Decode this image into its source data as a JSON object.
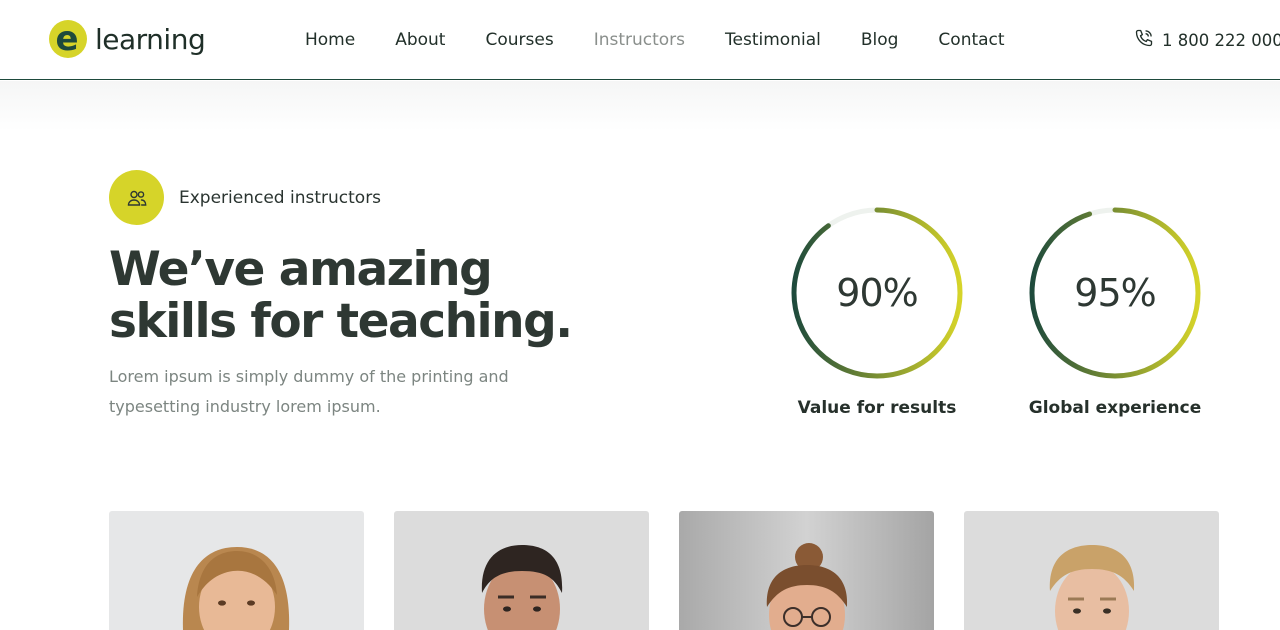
{
  "header": {
    "logo_text": "learning",
    "logo_letter": "e",
    "nav": [
      {
        "label": "Home",
        "active": false
      },
      {
        "label": "About",
        "active": false
      },
      {
        "label": "Courses",
        "active": false
      },
      {
        "label": "Instructors",
        "active": true
      },
      {
        "label": "Testimonial",
        "active": false
      },
      {
        "label": "Blog",
        "active": false
      },
      {
        "label": "Contact",
        "active": false
      }
    ],
    "phone": "1 800 222 000",
    "phone_icon": "phone-icon"
  },
  "intro": {
    "badge_icon": "users-icon",
    "badge_label": "Experienced instructors",
    "heading_line1": "We’ve amazing",
    "heading_line2": "skills for teaching.",
    "description": "Lorem ipsum is simply dummy of the printing and typesetting industry lorem ipsum."
  },
  "stats": [
    {
      "value": "90%",
      "percent": 90,
      "label": "Value for results"
    },
    {
      "value": "95%",
      "percent": 95,
      "label": "Global experience"
    }
  ],
  "instructors": [
    {
      "photo": "instructor-photo-woman-smiling"
    },
    {
      "photo": "instructor-photo-man-smiling"
    },
    {
      "photo": "instructor-photo-woman-glasses"
    },
    {
      "photo": "instructor-photo-man-man-bun"
    }
  ],
  "colors": {
    "brand_yellow": "#d6d429",
    "brand_green": "#1e4a3c",
    "text_dark": "#2e3833",
    "text_muted": "#7c8581"
  }
}
